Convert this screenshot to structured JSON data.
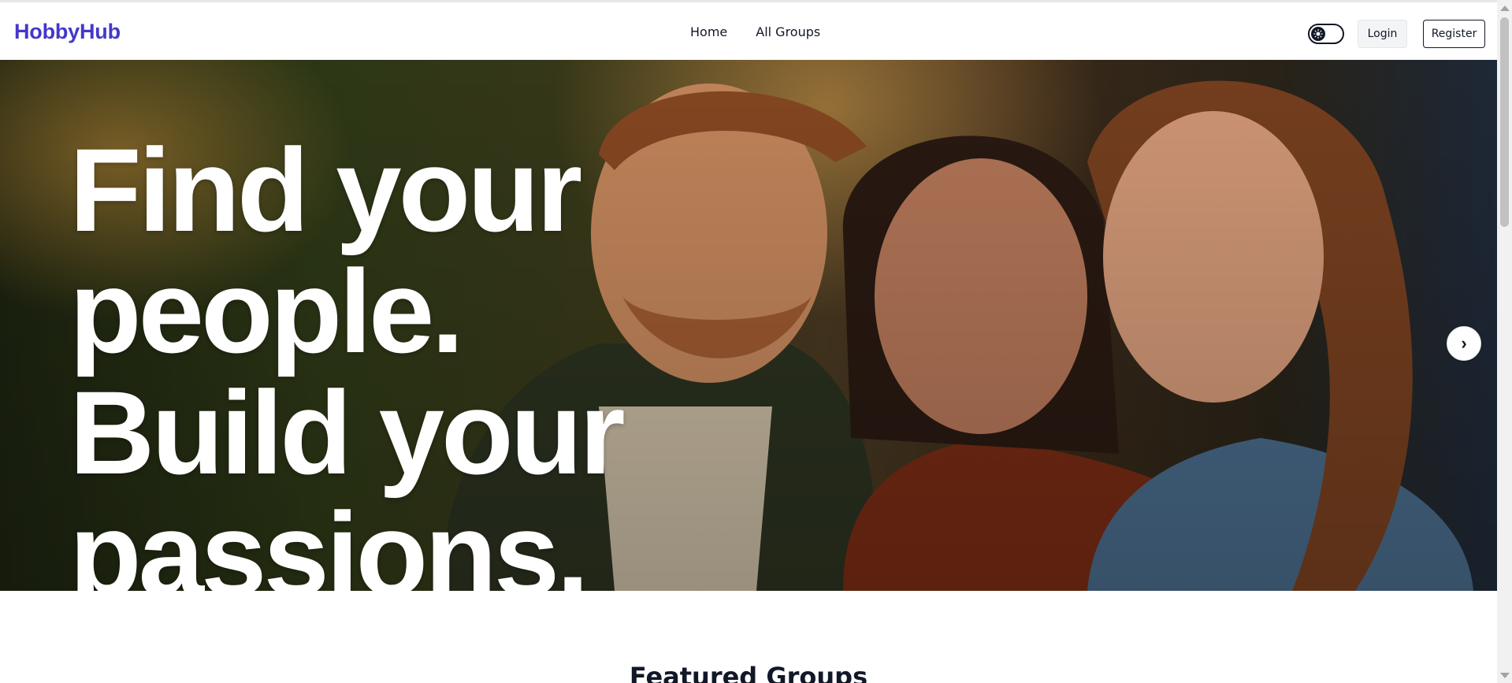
{
  "header": {
    "logo": "HobbyHub",
    "nav": [
      {
        "label": "Home"
      },
      {
        "label": "All Groups"
      }
    ],
    "theme_toggle_icon": "sun-icon",
    "login_label": "Login",
    "register_label": "Register"
  },
  "hero": {
    "lines": [
      "Find your",
      "people.",
      "Build your",
      "passions."
    ],
    "next_icon": "›"
  },
  "featured": {
    "title": "Featured Groups"
  },
  "colors": {
    "brand": "#4338ca",
    "text": "#111827"
  }
}
